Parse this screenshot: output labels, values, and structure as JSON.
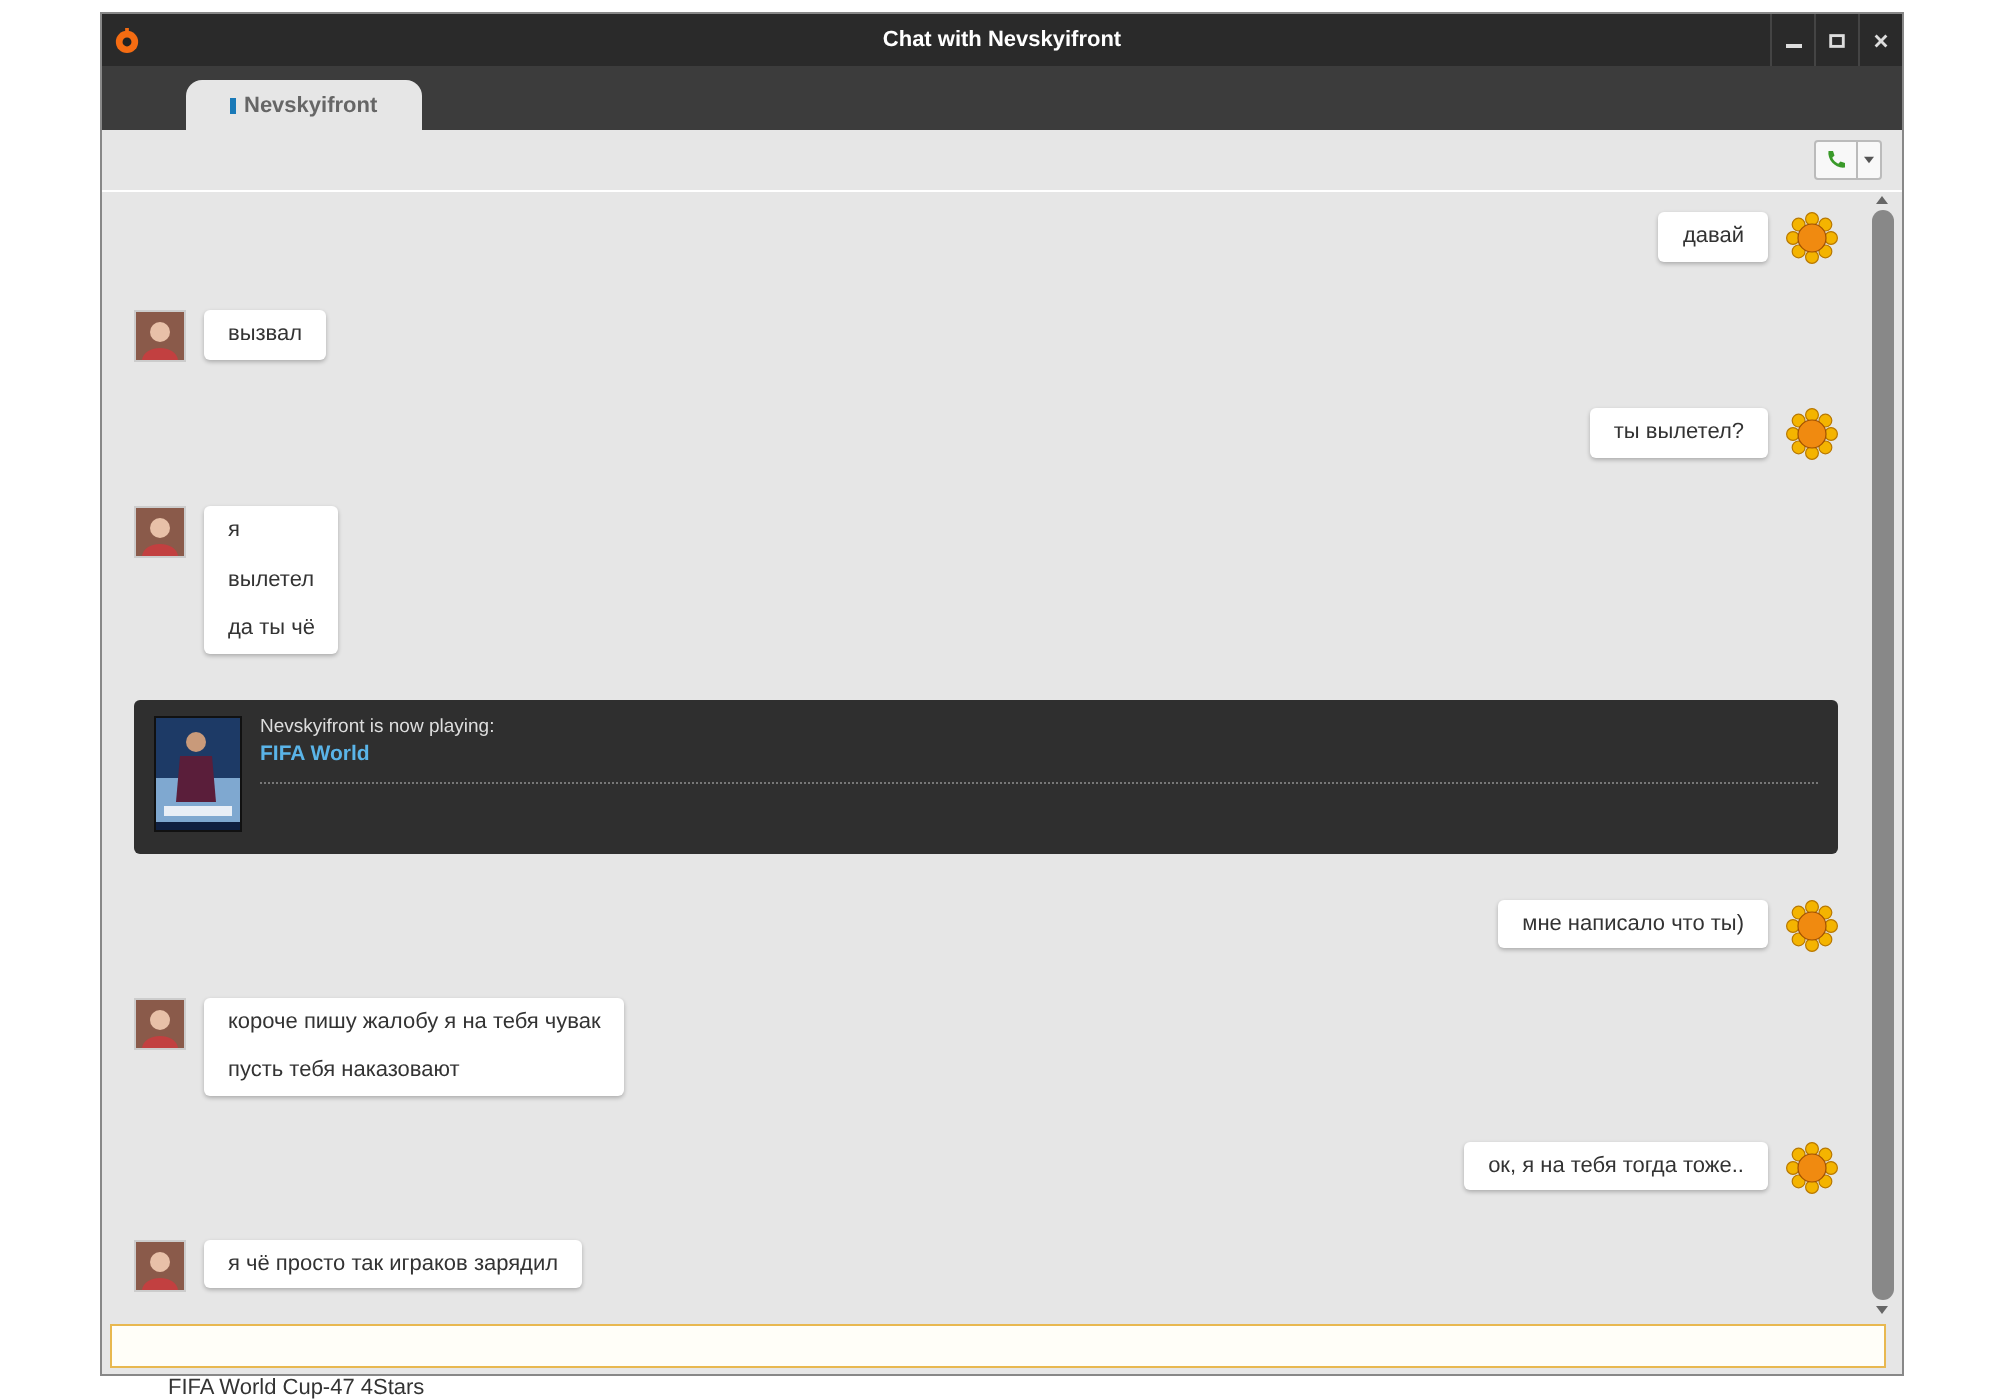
{
  "window": {
    "title": "Chat with Nevskyifront"
  },
  "tabs": [
    {
      "label": "Nevskyifront",
      "selected": true
    }
  ],
  "messages": [
    {
      "kind": "out",
      "lines": [
        "давай"
      ]
    },
    {
      "kind": "in",
      "lines": [
        "вызвал"
      ]
    },
    {
      "kind": "out",
      "lines": [
        "ты вылетел?"
      ]
    },
    {
      "kind": "in",
      "lines": [
        "я",
        "вылетел",
        "да ты чё"
      ]
    },
    {
      "kind": "activity",
      "text": "Nevskyifront is now playing:",
      "game": "FIFA World"
    },
    {
      "kind": "out",
      "lines": [
        "мне написало что ты)"
      ]
    },
    {
      "kind": "in",
      "lines": [
        "короче пишу жалобу я на тебя чувак",
        "пусть тебя наказовают"
      ]
    },
    {
      "kind": "out",
      "lines": [
        "ок, я на тебя тогда тоже.."
      ]
    },
    {
      "kind": "in",
      "lines": [
        "я чё просто так играков зарядил"
      ]
    }
  ],
  "background_text": "FIFA World Cup-47 4Stars"
}
